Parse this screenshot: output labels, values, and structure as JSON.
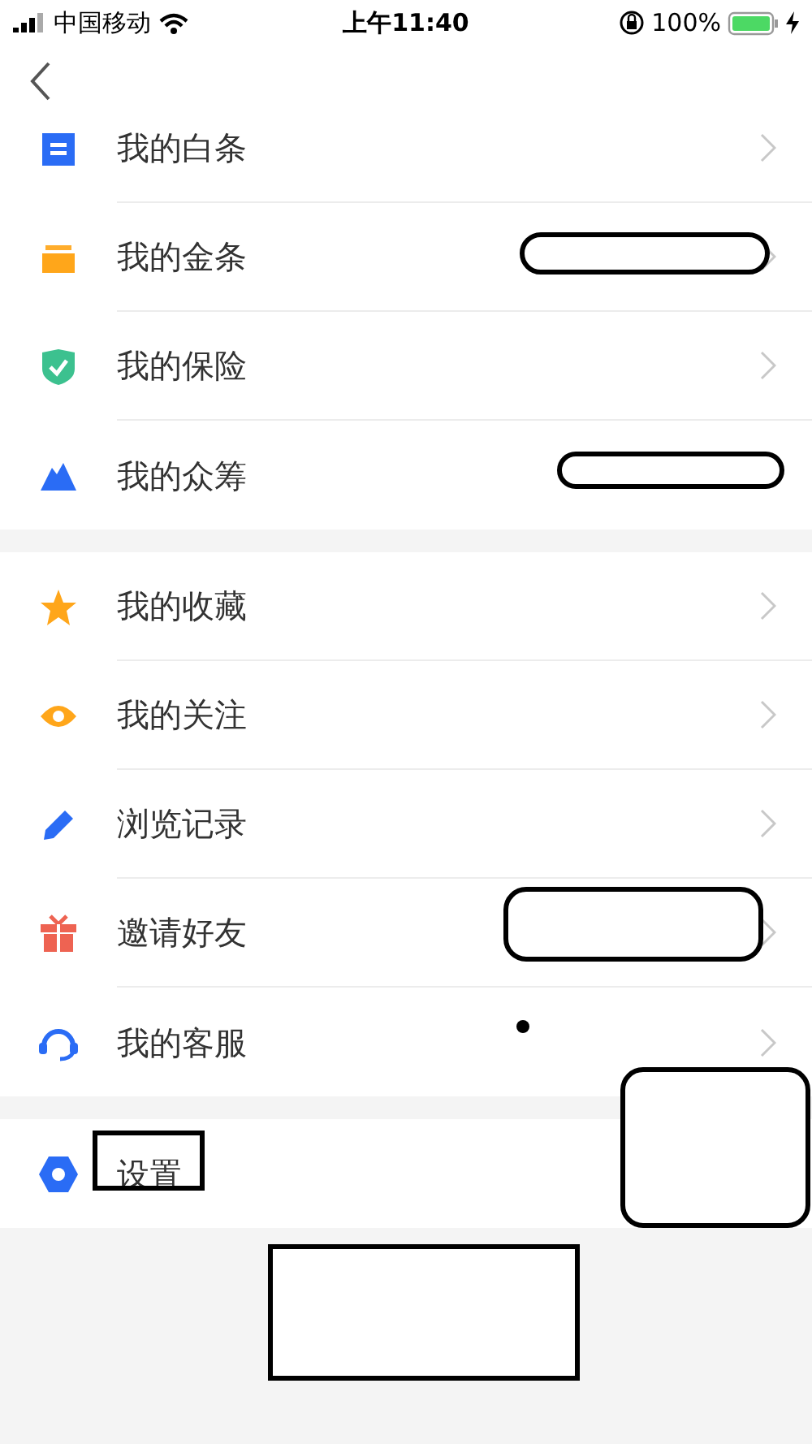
{
  "status_bar": {
    "carrier": "中国移动",
    "time": "上午11:40",
    "battery": "100%"
  },
  "groups": [
    {
      "rows": [
        {
          "label": "我的白条",
          "chevron": true
        },
        {
          "label": "我的金条",
          "chevron": true
        },
        {
          "label": "我的保险",
          "chevron": true
        },
        {
          "label": "我的众筹",
          "chevron": false
        }
      ]
    },
    {
      "rows": [
        {
          "label": "我的收藏",
          "chevron": true
        },
        {
          "label": "我的关注",
          "chevron": true
        },
        {
          "label": "浏览记录",
          "chevron": true
        },
        {
          "label": "邀请好友",
          "chevron": true
        },
        {
          "label": "我的客服",
          "chevron": true
        }
      ]
    },
    {
      "rows": [
        {
          "label": "设置",
          "chevron": false
        }
      ]
    }
  ],
  "annotations": [
    {
      "kind": "oval"
    },
    {
      "kind": "oval"
    },
    {
      "kind": "oval"
    },
    {
      "kind": "dot"
    },
    {
      "kind": "rounded_box"
    },
    {
      "kind": "frame"
    },
    {
      "kind": "box"
    }
  ]
}
